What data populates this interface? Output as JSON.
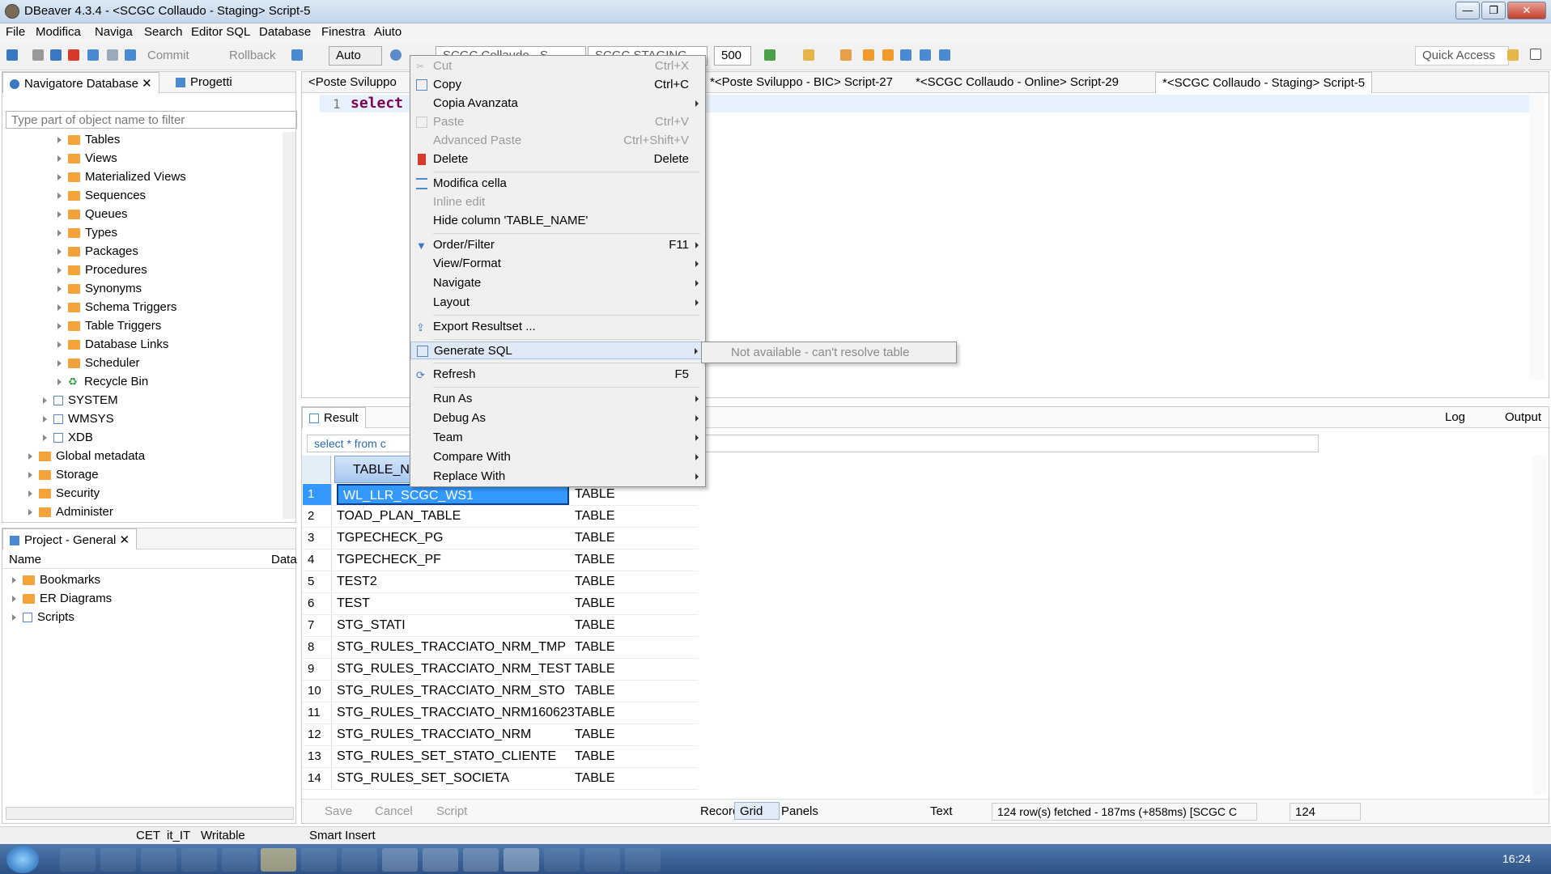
{
  "window": {
    "title": "DBeaver 4.3.4 - <SCGC Collaudo - Staging> Script-5"
  },
  "menubar": [
    "File",
    "Modifica",
    "Naviga",
    "Search",
    "Editor SQL",
    "Database",
    "Finestra",
    "Aiuto"
  ],
  "toolbar": {
    "commit": "Commit",
    "rollback": "Rollback",
    "mode": "Auto",
    "limit": "500",
    "quick_access": "Quick Access",
    "conn1": "SCGC Collaudo - S...",
    "conn2": "SCGC STAGING..."
  },
  "navigator": {
    "tab_label": "Navigatore Database",
    "tab2_label": "Progetti",
    "filter_placeholder": "Type part of object name to filter",
    "items": [
      "Tables",
      "Views",
      "Materialized Views",
      "Sequences",
      "Queues",
      "Types",
      "Packages",
      "Procedures",
      "Synonyms",
      "Schema Triggers",
      "Table Triggers",
      "Database Links",
      "Scheduler",
      "Recycle Bin"
    ],
    "schemas": [
      "SYSTEM",
      "WMSYS",
      "XDB"
    ],
    "root_items": [
      "Global metadata",
      "Storage",
      "Security",
      "Administer"
    ]
  },
  "project": {
    "tab_label": "Project - General",
    "col_name": "Name",
    "col_data": "Data",
    "items": [
      "Bookmarks",
      "ER Diagrams",
      "Scripts"
    ]
  },
  "editor_tabs": [
    "<Poste Sviluppo",
    "*<Poste Sviluppo - BIC> Script-27",
    "*<SCGC Collaudo - Online> Script-29",
    "*<SCGC Collaudo - Staging> Script-5"
  ],
  "editor": {
    "line_number": "1",
    "code": "select"
  },
  "result": {
    "tab_label": "Result",
    "log": "Log",
    "output": "Output",
    "query_filter": "select * from c",
    "column": "TABLE_N",
    "rows": [
      {
        "n": "1",
        "name": "WL_LLR_SCGC_WS1",
        "type": "TABLE"
      },
      {
        "n": "2",
        "name": "TOAD_PLAN_TABLE",
        "type": "TABLE"
      },
      {
        "n": "3",
        "name": "TGPECHECK_PG",
        "type": "TABLE"
      },
      {
        "n": "4",
        "name": "TGPECHECK_PF",
        "type": "TABLE"
      },
      {
        "n": "5",
        "name": "TEST2",
        "type": "TABLE"
      },
      {
        "n": "6",
        "name": "TEST",
        "type": "TABLE"
      },
      {
        "n": "7",
        "name": "STG_STATI",
        "type": "TABLE"
      },
      {
        "n": "8",
        "name": "STG_RULES_TRACCIATO_NRM_TMP",
        "type": "TABLE"
      },
      {
        "n": "9",
        "name": "STG_RULES_TRACCIATO_NRM_TEST",
        "type": "TABLE"
      },
      {
        "n": "10",
        "name": "STG_RULES_TRACCIATO_NRM_STO",
        "type": "TABLE"
      },
      {
        "n": "11",
        "name": "STG_RULES_TRACCIATO_NRM160623",
        "type": "TABLE"
      },
      {
        "n": "12",
        "name": "STG_RULES_TRACCIATO_NRM",
        "type": "TABLE"
      },
      {
        "n": "13",
        "name": "STG_RULES_SET_STATO_CLIENTE",
        "type": "TABLE"
      },
      {
        "n": "14",
        "name": "STG_RULES_SET_SOCIETA",
        "type": "TABLE"
      }
    ],
    "bottom": {
      "save": "Save",
      "cancel": "Cancel",
      "script": "Script",
      "record": "Record",
      "panels": "Panels",
      "grid": "Grid",
      "text": "Text",
      "status": "124 row(s) fetched - 187ms (+858ms) [SCGC C",
      "count": "124"
    }
  },
  "context_menu": [
    {
      "label": "Cut",
      "shortcut": "Ctrl+X",
      "disabled": true
    },
    {
      "label": "Copy",
      "shortcut": "Ctrl+C"
    },
    {
      "label": "Copia Avanzata",
      "submenu": true
    },
    {
      "label": "Paste",
      "shortcut": "Ctrl+V",
      "disabled": true
    },
    {
      "label": "Advanced Paste",
      "shortcut": "Ctrl+Shift+V",
      "disabled": true
    },
    {
      "label": "Delete",
      "shortcut": "Delete"
    },
    {
      "label": "Modifica cella"
    },
    {
      "label": "Inline edit",
      "disabled": true
    },
    {
      "label": "Hide column 'TABLE_NAME'"
    },
    {
      "label": "Order/Filter",
      "shortcut": "F11",
      "submenu": true
    },
    {
      "label": "View/Format",
      "submenu": true
    },
    {
      "label": "Navigate",
      "submenu": true
    },
    {
      "label": "Layout",
      "submenu": true
    },
    {
      "label": "Export Resultset ..."
    },
    {
      "label": "Generate SQL",
      "submenu": true,
      "highlighted": true
    },
    {
      "label": "Refresh",
      "shortcut": "F5"
    },
    {
      "label": "Run As",
      "submenu": true
    },
    {
      "label": "Debug As",
      "submenu": true
    },
    {
      "label": "Team",
      "submenu": true
    },
    {
      "label": "Compare With",
      "submenu": true
    },
    {
      "label": "Replace With",
      "submenu": true
    }
  ],
  "submenu_text": "Not available - can't resolve table",
  "statusbar": {
    "tz": "CET",
    "locale": "it_IT",
    "mode": "Writable",
    "insert": "Smart Insert"
  },
  "taskbar": {
    "clock": "16:24"
  },
  "colors": {
    "selection": "#3399ff",
    "menu_highlight": "#dfe9f5",
    "folder": "#f2a33a"
  }
}
